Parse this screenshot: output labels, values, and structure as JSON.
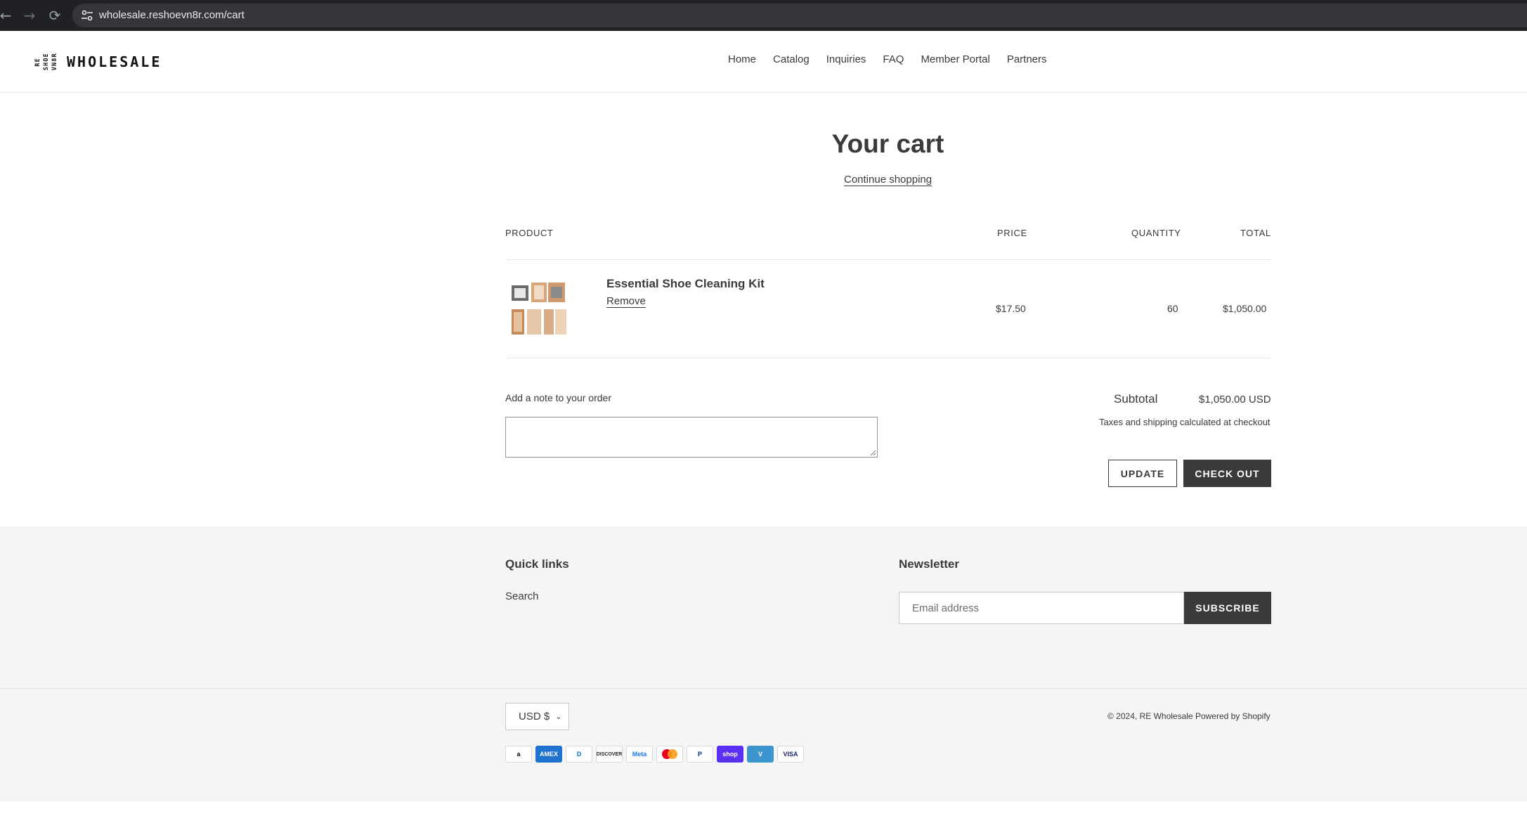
{
  "browser": {
    "url": "wholesale.reshoevn8r.com/cart"
  },
  "header": {
    "logo_cols": [
      "RE",
      "SHOE",
      "VN8R"
    ],
    "logo_text": "WHOLESALE",
    "nav": [
      {
        "label": "Home"
      },
      {
        "label": "Catalog"
      },
      {
        "label": "Inquiries"
      },
      {
        "label": "FAQ"
      },
      {
        "label": "Member Portal"
      },
      {
        "label": "Partners"
      }
    ]
  },
  "cart": {
    "title": "Your cart",
    "continue_label": "Continue shopping",
    "columns": {
      "product": "PRODUCT",
      "price": "PRICE",
      "quantity": "QUANTITY",
      "total": "TOTAL"
    },
    "items": [
      {
        "name": "Essential Shoe Cleaning Kit",
        "remove_label": "Remove",
        "price": "$17.50",
        "quantity": "60",
        "total": "$1,050.00"
      }
    ],
    "note_label": "Add a note to your order",
    "subtotal_label": "Subtotal",
    "subtotal_value": "$1,050.00 USD",
    "tax_note": "Taxes and shipping calculated at checkout",
    "update_label": "UPDATE",
    "checkout_label": "CHECK OUT"
  },
  "footer": {
    "quick_links_title": "Quick links",
    "quick_links": [
      {
        "label": "Search"
      }
    ],
    "newsletter_title": "Newsletter",
    "email_placeholder": "Email address",
    "subscribe_label": "SUBSCRIBE",
    "currency": "USD $",
    "copyright_prefix": "© 2024,",
    "store_name": "RE Wholesale",
    "powered_by": "Powered by Shopify",
    "payment_icons": [
      {
        "label": "a",
        "icon": "amazon-icon",
        "bg": "#ffffff",
        "fg": "#000000",
        "border": "#d9d9d9"
      },
      {
        "label": "AMEX",
        "icon": "amex-icon",
        "bg": "#1f72cd",
        "fg": "#ffffff",
        "border": "#1f72cd"
      },
      {
        "label": "D",
        "icon": "diners-icon",
        "bg": "#ffffff",
        "fg": "#0079be",
        "border": "#d9d9d9"
      },
      {
        "label": "DISCOVER",
        "icon": "discover-icon",
        "bg": "#ffffff",
        "fg": "#231f20",
        "border": "#d9d9d9"
      },
      {
        "label": "Meta",
        "icon": "meta-pay-icon",
        "bg": "#ffffff",
        "fg": "#1877f2",
        "border": "#d9d9d9"
      },
      {
        "label": "",
        "icon": "mastercard-icon",
        "bg": "#ffffff",
        "fg": "#000000",
        "border": "#d9d9d9"
      },
      {
        "label": "P",
        "icon": "paypal-icon",
        "bg": "#ffffff",
        "fg": "#003087",
        "border": "#d9d9d9"
      },
      {
        "label": "shop",
        "icon": "shop-pay-icon",
        "bg": "#5a31f4",
        "fg": "#ffffff",
        "border": "#5a31f4"
      },
      {
        "label": "V",
        "icon": "venmo-icon",
        "bg": "#3d95ce",
        "fg": "#ffffff",
        "border": "#3d95ce"
      },
      {
        "label": "VISA",
        "icon": "visa-icon",
        "bg": "#ffffff",
        "fg": "#1a1f71",
        "border": "#d9d9d9"
      }
    ]
  },
  "colors": {
    "text": "#3a3a3a",
    "button_dark": "#3a3a3a",
    "footer_bg": "#f5f5f5",
    "chrome_bg": "#202124"
  }
}
